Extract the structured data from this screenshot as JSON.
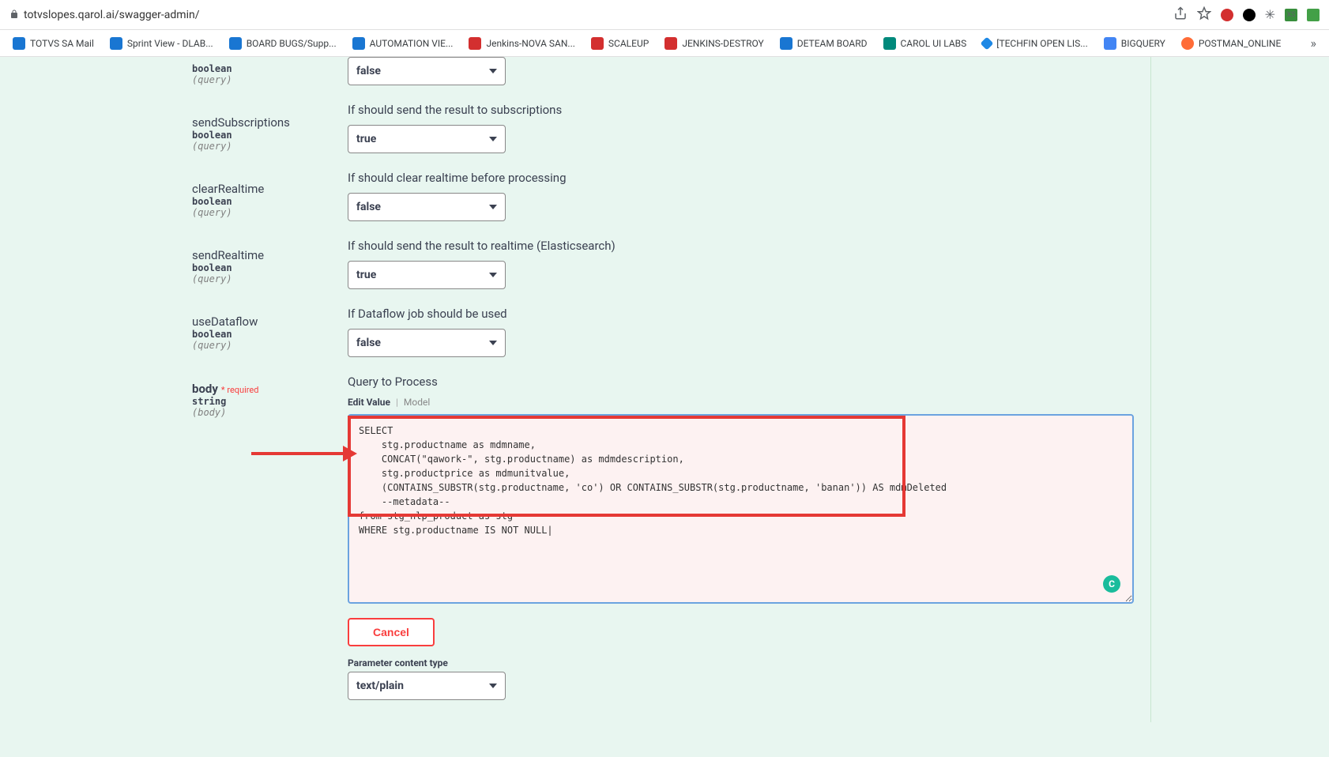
{
  "browser": {
    "url": "totvslopes.qarol.ai/swagger-admin/"
  },
  "bookmarks": [
    {
      "label": "TOTVS SA Mail"
    },
    {
      "label": "Sprint View - DLAB..."
    },
    {
      "label": "BOARD BUGS/Supp..."
    },
    {
      "label": "AUTOMATION VIE..."
    },
    {
      "label": "Jenkins-NOVA SAN..."
    },
    {
      "label": "SCALEUP"
    },
    {
      "label": "JENKINS-DESTROY"
    },
    {
      "label": "DETEAM BOARD"
    },
    {
      "label": "CAROL UI LABS"
    },
    {
      "label": "[TECHFIN OPEN LIS..."
    },
    {
      "label": "BIGQUERY"
    },
    {
      "label": "POSTMAN_ONLINE"
    }
  ],
  "params": {
    "cdc": {
      "type": "boolean",
      "in": "(query)",
      "desc_partial": "",
      "value": "false"
    },
    "sendSubscriptions": {
      "name": "sendSubscriptions",
      "type": "boolean",
      "in": "(query)",
      "desc": "If should send the result to subscriptions",
      "value": "true"
    },
    "clearRealtime": {
      "name": "clearRealtime",
      "type": "boolean",
      "in": "(query)",
      "desc": "If should clear realtime before processing",
      "value": "false"
    },
    "sendRealtime": {
      "name": "sendRealtime",
      "type": "boolean",
      "in": "(query)",
      "desc": "If should send the result to realtime (Elasticsearch)",
      "value": "true"
    },
    "useDataflow": {
      "name": "useDataflow",
      "type": "boolean",
      "in": "(query)",
      "desc": "If Dataflow job should be used",
      "value": "false"
    },
    "body": {
      "name": "body",
      "required": "* required",
      "type": "string",
      "in": "(body)",
      "desc": "Query to Process"
    }
  },
  "tabs": {
    "editValue": "Edit Value",
    "model": "Model"
  },
  "query": "SELECT\n    stg.productname as mdmname,\n    CONCAT(\"qawork-\", stg.productname) as mdmdescription,\n    stg.productprice as mdmunitvalue,\n    (CONTAINS_SUBSTR(stg.productname, 'co') OR CONTAINS_SUBSTR(stg.productname, 'banan')) AS mdmDeleted\n    --metadata--\nfrom stg_nlp_product as stg\nWHERE stg.productname IS NOT NULL|",
  "buttons": {
    "cancel": "Cancel"
  },
  "contentType": {
    "label": "Parameter content type",
    "value": "text/plain"
  },
  "badge": "C"
}
